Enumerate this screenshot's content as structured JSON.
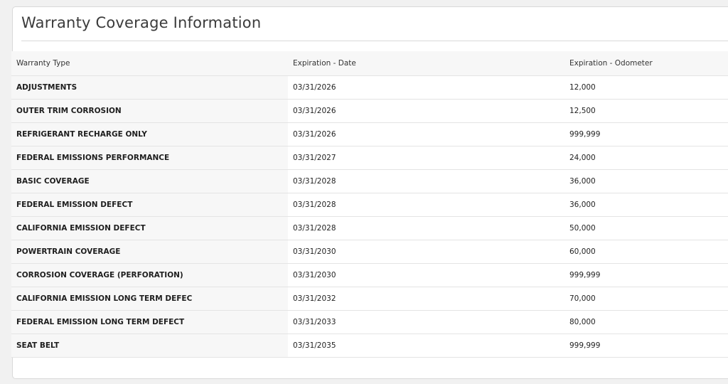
{
  "panel": {
    "title": "Warranty Coverage Information"
  },
  "table": {
    "headers": {
      "type": "Warranty Type",
      "date": "Expiration - Date",
      "odometer": "Expiration - Odometer"
    },
    "rows": [
      {
        "type": "ADJUSTMENTS",
        "date": "03/31/2026",
        "odometer": "12,000"
      },
      {
        "type": "OUTER TRIM CORROSION",
        "date": "03/31/2026",
        "odometer": "12,500"
      },
      {
        "type": "REFRIGERANT RECHARGE ONLY",
        "date": "03/31/2026",
        "odometer": "999,999"
      },
      {
        "type": "FEDERAL EMISSIONS PERFORMANCE",
        "date": "03/31/2027",
        "odometer": "24,000"
      },
      {
        "type": "BASIC COVERAGE",
        "date": "03/31/2028",
        "odometer": "36,000"
      },
      {
        "type": "FEDERAL EMISSION DEFECT",
        "date": "03/31/2028",
        "odometer": "36,000"
      },
      {
        "type": "CALIFORNIA EMISSION DEFECT",
        "date": "03/31/2028",
        "odometer": "50,000"
      },
      {
        "type": "POWERTRAIN COVERAGE",
        "date": "03/31/2030",
        "odometer": "60,000"
      },
      {
        "type": "CORROSION COVERAGE (PERFORATION)",
        "date": "03/31/2030",
        "odometer": "999,999"
      },
      {
        "type": "CALIFORNIA EMISSION LONG TERM DEFEC",
        "date": "03/31/2032",
        "odometer": "70,000"
      },
      {
        "type": "FEDERAL EMISSION LONG TERM DEFECT",
        "date": "03/31/2033",
        "odometer": "80,000"
      },
      {
        "type": "SEAT BELT",
        "date": "03/31/2035",
        "odometer": "999,999"
      }
    ]
  }
}
